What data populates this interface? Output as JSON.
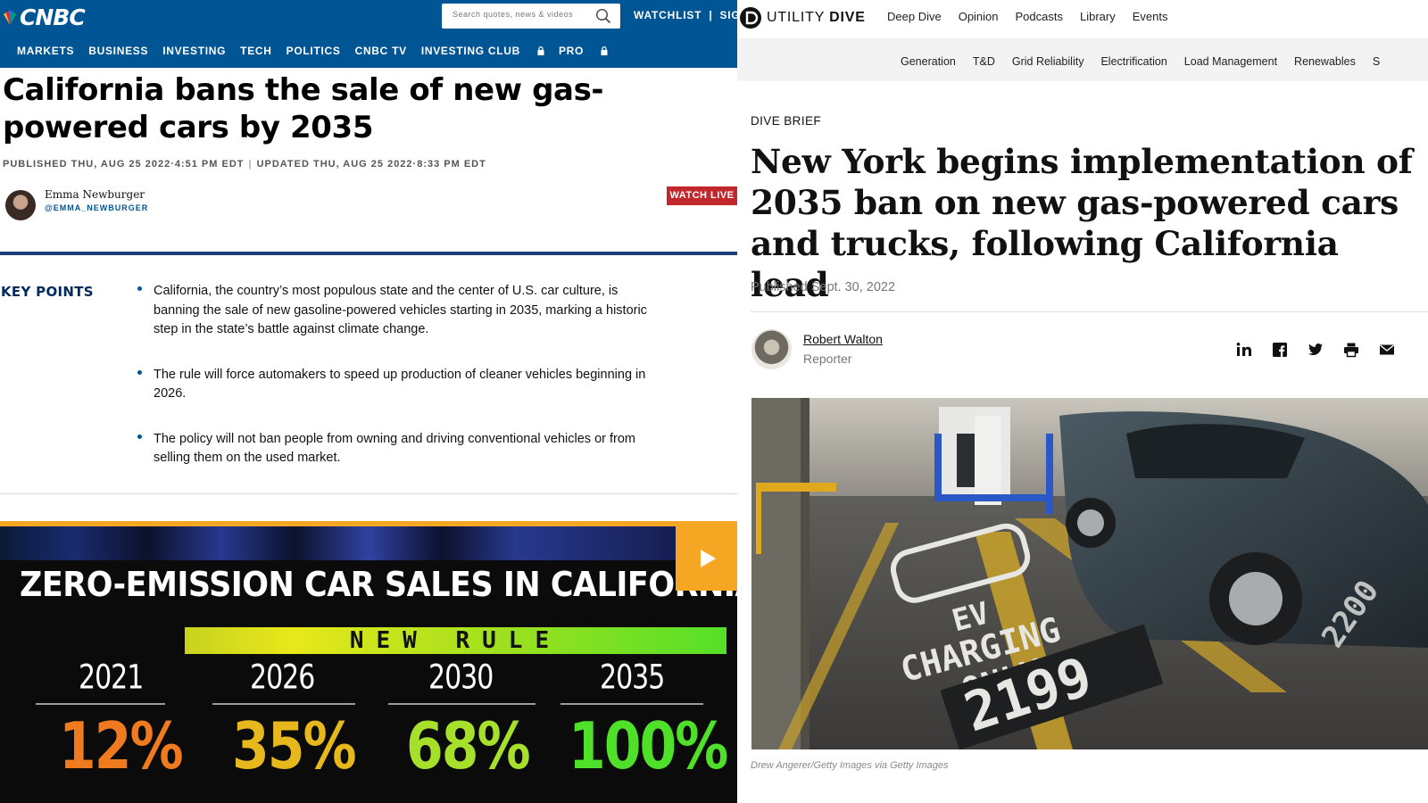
{
  "cnbc": {
    "logo": "CNBC",
    "search_placeholder": "Search quotes, news & videos",
    "top_links": {
      "watchlist": "WATCHLIST",
      "separator": "|",
      "signin": "SIG"
    },
    "nav": [
      "MARKETS",
      "BUSINESS",
      "INVESTING",
      "TECH",
      "POLITICS",
      "CNBC TV",
      "INVESTING CLUB",
      "PRO"
    ],
    "headline": "California bans the sale of new gas-powered cars by 2035",
    "published": "PUBLISHED THU, AUG 25 2022·4:51 PM EDT",
    "updated": "UPDATED THU, AUG 25 2022·8:33 PM EDT",
    "author": "Emma Newburger",
    "author_handle": "@EMMA_NEWBURGER",
    "watch_live": "WATCH LIVE",
    "key_points_label": "KEY POINTS",
    "key_points": [
      "California, the country’s most populous state and the center of U.S. car culture, is banning the sale of new gasoline-powered vehicles starting in 2035, marking a historic step in the state’s battle against climate change.",
      "The rule will force automakers to speed up production of cleaner vehicles beginning in 2026.",
      "The policy will not ban people from owning and driving conventional vehicles or from selling them on the used market."
    ],
    "video": {
      "title": "ZERO-EMISSION CAR SALES IN CALIFORNIA",
      "band": "NEW RULE",
      "years": [
        "2021",
        "2026",
        "2030",
        "2035"
      ],
      "percents": [
        "12%",
        "35%",
        "68%",
        "100%"
      ],
      "percent_colors": [
        "#f07a1e",
        "#e6b81c",
        "#a6e02a",
        "#4fe02a"
      ]
    },
    "colors": {
      "brand": "#005594",
      "watch_live": "#c1272d",
      "video_accent": "#f5a623"
    }
  },
  "ud": {
    "logo_light": "UTILITY",
    "logo_bold": "DIVE",
    "main_nav": [
      "Deep Dive",
      "Opinion",
      "Podcasts",
      "Library",
      "Events"
    ],
    "sub_nav": [
      "Generation",
      "T&D",
      "Grid Reliability",
      "Electrification",
      "Load Management",
      "Renewables",
      "S"
    ],
    "kicker": "DIVE BRIEF",
    "headline": "New York begins implementation of 2035 ban on new gas-powered cars and trucks, following California lead",
    "published": "Published Sept. 30, 2022",
    "author": "Robert Walton",
    "role": "Reporter",
    "share_icons": [
      "linkedin-icon",
      "facebook-icon",
      "twitter-icon",
      "print-icon",
      "email-icon"
    ],
    "photo_stencil": [
      "EV",
      "CHARGING",
      "ONLY"
    ],
    "photo_space_number": "2199",
    "photo_pillar_number": "2200",
    "caption": "Drew Angerer/Getty Images via Getty Images"
  }
}
